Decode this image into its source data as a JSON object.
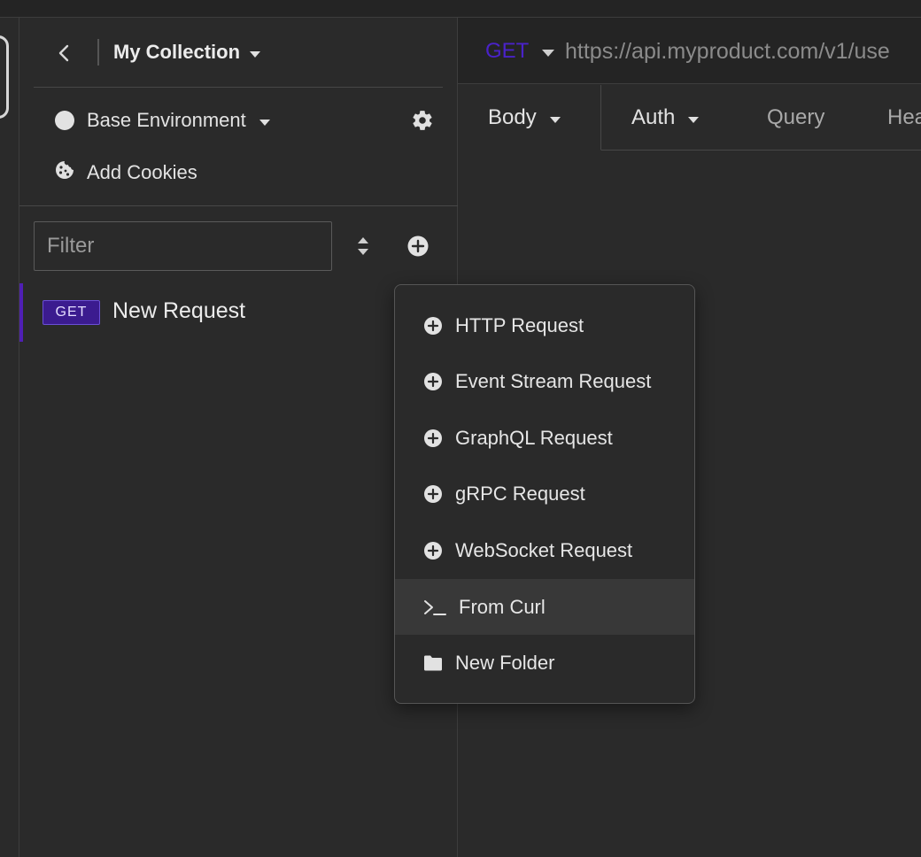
{
  "collection": {
    "title": "My Collection"
  },
  "environment": {
    "label": "Base Environment"
  },
  "cookies": {
    "label": "Add Cookies"
  },
  "filter": {
    "placeholder": "Filter"
  },
  "requests": [
    {
      "method": "GET",
      "name": "New Request"
    }
  ],
  "url_bar": {
    "method": "GET",
    "url": "https://api.myproduct.com/v1/use"
  },
  "tabs": [
    {
      "label": "Body"
    },
    {
      "label": "Auth"
    },
    {
      "label": "Query"
    },
    {
      "label": "Hea"
    }
  ],
  "menu": {
    "items": [
      {
        "label": "HTTP Request",
        "icon": "plus-circle-icon"
      },
      {
        "label": "Event Stream Request",
        "icon": "plus-circle-icon"
      },
      {
        "label": "GraphQL Request",
        "icon": "plus-circle-icon"
      },
      {
        "label": "gRPC Request",
        "icon": "plus-circle-icon"
      },
      {
        "label": "WebSocket Request",
        "icon": "plus-circle-icon"
      },
      {
        "label": "From Curl",
        "icon": "terminal-icon"
      },
      {
        "label": "New Folder",
        "icon": "folder-icon"
      }
    ],
    "highlighted": "From Curl"
  },
  "colors": {
    "accent": "#4f1fb4",
    "get_badge_bg": "#3b1b8f",
    "get_text": "#4a22c9"
  }
}
